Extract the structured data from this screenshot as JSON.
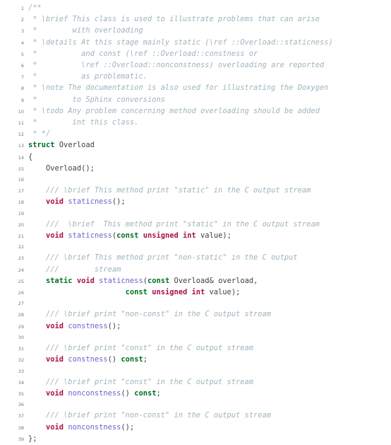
{
  "view": {
    "kind": "source-code-listing",
    "language": "C++",
    "line_numbers_shown": true,
    "first_line": 1,
    "last_line": 39,
    "background_color": "#ffffff",
    "colors": {
      "comment": "#a0b4bd",
      "type_keyword": "#aa1144",
      "declaration_keyword": "#007020",
      "function_name": "#6666cc",
      "plain_text": "#404040",
      "line_number": "#777777"
    }
  },
  "lines": [
    {
      "num": "1",
      "tokens": [
        {
          "t": "/**",
          "c": "c"
        }
      ]
    },
    {
      "num": "2",
      "tokens": [
        {
          "t": " * \\brief This class is used to illustrate problems that can arise",
          "c": "c"
        }
      ]
    },
    {
      "num": "3",
      "tokens": [
        {
          "t": " *        with overloading",
          "c": "c"
        }
      ]
    },
    {
      "num": "4",
      "tokens": [
        {
          "t": " * \\details At this stage mainly static (\\ref ::Overload::staticness)",
          "c": "c"
        }
      ]
    },
    {
      "num": "5",
      "tokens": [
        {
          "t": " *          and const (\\ref ::Overload::constness or",
          "c": "c"
        }
      ]
    },
    {
      "num": "6",
      "tokens": [
        {
          "t": " *          \\ref ::Overload::nonconstness) overloading are reported",
          "c": "c"
        }
      ]
    },
    {
      "num": "7",
      "tokens": [
        {
          "t": " *          as problematic.",
          "c": "c"
        }
      ]
    },
    {
      "num": "8",
      "tokens": [
        {
          "t": " * \\note The documentation is also used for illustrating the Doxygen",
          "c": "c"
        }
      ]
    },
    {
      "num": "9",
      "tokens": [
        {
          "t": " *        to Sphinx conversions",
          "c": "c"
        }
      ]
    },
    {
      "num": "10",
      "tokens": [
        {
          "t": " * \\todo Any problem concerning method overloading should be added",
          "c": "c"
        }
      ]
    },
    {
      "num": "11",
      "tokens": [
        {
          "t": " *        int this class.",
          "c": "c"
        }
      ]
    },
    {
      "num": "12",
      "tokens": [
        {
          "t": " * */",
          "c": "c"
        }
      ]
    },
    {
      "num": "13",
      "tokens": [
        {
          "t": "struct",
          "c": "kd"
        },
        {
          "t": " Overload",
          "c": "n"
        }
      ]
    },
    {
      "num": "14",
      "tokens": [
        {
          "t": "{",
          "c": "p"
        }
      ]
    },
    {
      "num": "15",
      "tokens": [
        {
          "t": "    Overload();",
          "c": "n"
        }
      ]
    },
    {
      "num": "16",
      "tokens": [
        {
          "t": "",
          "c": "n"
        }
      ]
    },
    {
      "num": "17",
      "tokens": [
        {
          "t": "    /// \\brief This method print \"static\" in the C output stream",
          "c": "c"
        }
      ]
    },
    {
      "num": "18",
      "tokens": [
        {
          "t": "    ",
          "c": "n"
        },
        {
          "t": "void",
          "c": "k"
        },
        {
          "t": " ",
          "c": "n"
        },
        {
          "t": "staticness",
          "c": "nf"
        },
        {
          "t": "();",
          "c": "p"
        }
      ]
    },
    {
      "num": "19",
      "tokens": [
        {
          "t": "",
          "c": "n"
        }
      ]
    },
    {
      "num": "20",
      "tokens": [
        {
          "t": "    ///  \\brief  This method print \"static\" in the C output stream",
          "c": "c"
        }
      ]
    },
    {
      "num": "21",
      "tokens": [
        {
          "t": "    ",
          "c": "n"
        },
        {
          "t": "void",
          "c": "k"
        },
        {
          "t": " ",
          "c": "n"
        },
        {
          "t": "staticness",
          "c": "nf"
        },
        {
          "t": "(",
          "c": "p"
        },
        {
          "t": "const",
          "c": "kd"
        },
        {
          "t": " ",
          "c": "n"
        },
        {
          "t": "unsigned",
          "c": "k"
        },
        {
          "t": " ",
          "c": "n"
        },
        {
          "t": "int",
          "c": "k"
        },
        {
          "t": " value);",
          "c": "n"
        }
      ]
    },
    {
      "num": "22",
      "tokens": [
        {
          "t": "",
          "c": "n"
        }
      ]
    },
    {
      "num": "23",
      "tokens": [
        {
          "t": "    /// \\brief This method print \"non-static\" in the C output",
          "c": "c"
        }
      ]
    },
    {
      "num": "24",
      "tokens": [
        {
          "t": "    ///        stream",
          "c": "c"
        }
      ]
    },
    {
      "num": "25",
      "tokens": [
        {
          "t": "    ",
          "c": "n"
        },
        {
          "t": "static",
          "c": "kd"
        },
        {
          "t": " ",
          "c": "n"
        },
        {
          "t": "void",
          "c": "k"
        },
        {
          "t": " ",
          "c": "n"
        },
        {
          "t": "staticness",
          "c": "nf"
        },
        {
          "t": "(",
          "c": "p"
        },
        {
          "t": "const",
          "c": "kd"
        },
        {
          "t": " Overload& overload,",
          "c": "n"
        }
      ]
    },
    {
      "num": "26",
      "tokens": [
        {
          "t": "                      ",
          "c": "n"
        },
        {
          "t": "const",
          "c": "kd"
        },
        {
          "t": " ",
          "c": "n"
        },
        {
          "t": "unsigned",
          "c": "k"
        },
        {
          "t": " ",
          "c": "n"
        },
        {
          "t": "int",
          "c": "k"
        },
        {
          "t": " value);",
          "c": "n"
        }
      ]
    },
    {
      "num": "27",
      "tokens": [
        {
          "t": "",
          "c": "n"
        }
      ]
    },
    {
      "num": "28",
      "tokens": [
        {
          "t": "    /// \\brief print \"non-const\" in the C output stream",
          "c": "c"
        }
      ]
    },
    {
      "num": "29",
      "tokens": [
        {
          "t": "    ",
          "c": "n"
        },
        {
          "t": "void",
          "c": "k"
        },
        {
          "t": " ",
          "c": "n"
        },
        {
          "t": "constness",
          "c": "nf"
        },
        {
          "t": "();",
          "c": "p"
        }
      ]
    },
    {
      "num": "30",
      "tokens": [
        {
          "t": "",
          "c": "n"
        }
      ]
    },
    {
      "num": "31",
      "tokens": [
        {
          "t": "    /// \\brief print \"const\" in the C output stream",
          "c": "c"
        }
      ]
    },
    {
      "num": "32",
      "tokens": [
        {
          "t": "    ",
          "c": "n"
        },
        {
          "t": "void",
          "c": "k"
        },
        {
          "t": " ",
          "c": "n"
        },
        {
          "t": "constness",
          "c": "nf"
        },
        {
          "t": "() ",
          "c": "p"
        },
        {
          "t": "const",
          "c": "kd"
        },
        {
          "t": ";",
          "c": "p"
        }
      ]
    },
    {
      "num": "33",
      "tokens": [
        {
          "t": "",
          "c": "n"
        }
      ]
    },
    {
      "num": "34",
      "tokens": [
        {
          "t": "    /// \\brief print \"const\" in the C output stream",
          "c": "c"
        }
      ]
    },
    {
      "num": "35",
      "tokens": [
        {
          "t": "    ",
          "c": "n"
        },
        {
          "t": "void",
          "c": "k"
        },
        {
          "t": " ",
          "c": "n"
        },
        {
          "t": "nonconstness",
          "c": "nf"
        },
        {
          "t": "() ",
          "c": "p"
        },
        {
          "t": "const",
          "c": "kd"
        },
        {
          "t": ";",
          "c": "p"
        }
      ]
    },
    {
      "num": "36",
      "tokens": [
        {
          "t": "",
          "c": "n"
        }
      ]
    },
    {
      "num": "37",
      "tokens": [
        {
          "t": "    /// \\brief print \"non-const\" in the C output stream",
          "c": "c"
        }
      ]
    },
    {
      "num": "38",
      "tokens": [
        {
          "t": "    ",
          "c": "n"
        },
        {
          "t": "void",
          "c": "k"
        },
        {
          "t": " ",
          "c": "n"
        },
        {
          "t": "nonconstness",
          "c": "nf"
        },
        {
          "t": "();",
          "c": "p"
        }
      ]
    },
    {
      "num": "39",
      "tokens": [
        {
          "t": "};",
          "c": "p"
        }
      ]
    }
  ]
}
